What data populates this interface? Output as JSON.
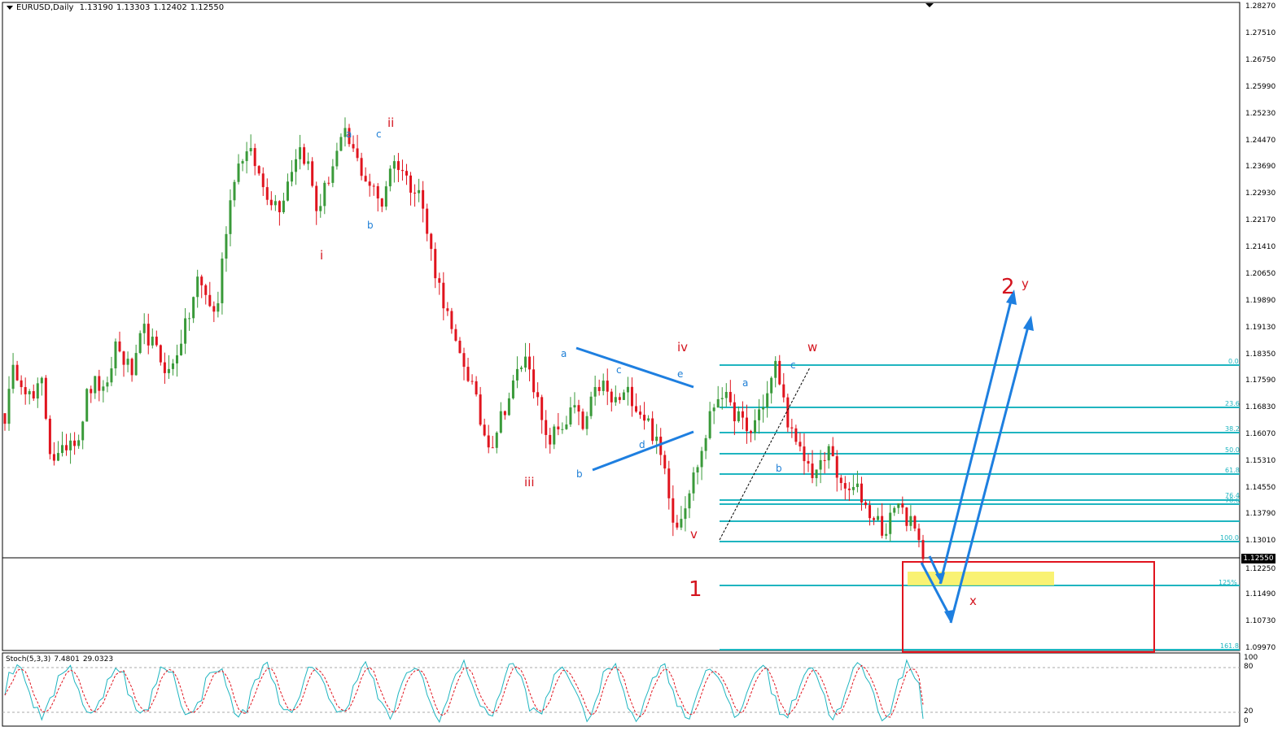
{
  "header": {
    "symbol": "EURUSD,Daily",
    "open": "1.13190",
    "high": "1.13303",
    "low": "1.12402",
    "close": "1.12550"
  },
  "stoch_header": {
    "name": "Stoch(5,3,3)",
    "main": "7.4801",
    "signal": "29.0323"
  },
  "current_price": "1.12550",
  "price_axis": [
    "1.28270",
    "1.27510",
    "1.26750",
    "1.25990",
    "1.25230",
    "1.24470",
    "1.23690",
    "1.22930",
    "1.22170",
    "1.21410",
    "1.20650",
    "1.19890",
    "1.19130",
    "1.18350",
    "1.17590",
    "1.16830",
    "1.16070",
    "1.15310",
    "1.14550",
    "1.13790",
    "1.13010",
    "1.12250",
    "1.11490",
    "1.10730",
    "1.09970"
  ],
  "stoch_axis": [
    "100",
    "80",
    "20",
    "0"
  ],
  "fib_levels": [
    "0.0",
    "23.6",
    "38.2",
    "50.0",
    "61.8",
    "76.4",
    "78.6",
    "100.0",
    "125%",
    "161.8"
  ],
  "wave_labels": {
    "i": "i",
    "ii": "ii",
    "iii": "iii",
    "iv": "iv",
    "v": "v",
    "one": "1",
    "two": "2",
    "w": "w",
    "x": "x",
    "y": "y",
    "a1": "a",
    "b1": "b",
    "c1": "c",
    "a2": "a",
    "b2": "b",
    "c2": "c",
    "d2": "d",
    "e2": "e",
    "a3": "a",
    "b3": "b",
    "c3": "c"
  },
  "colors": {
    "bull": "#3a9a3a",
    "bear": "#e0141e",
    "fib": "#1fb5c0",
    "arrow": "#1e7fe0",
    "label_red": "#d4141e",
    "label_blue": "#1e7fd6",
    "highlight": "#f8f05a",
    "target_box": "#e0141e"
  },
  "chart_data": {
    "type": "candlestick",
    "symbol": "EURUSD",
    "timeframe": "Daily",
    "ylim": [
      1.0997,
      1.2827
    ],
    "current_price": 1.1255,
    "close_anchors": [
      1.166,
      1.18,
      1.176,
      1.17,
      1.176,
      1.155,
      1.154,
      1.16,
      1.16,
      1.173,
      1.176,
      1.171,
      1.187,
      1.182,
      1.178,
      1.191,
      1.187,
      1.182,
      1.178,
      1.187,
      1.194,
      1.205,
      1.2,
      1.194,
      1.218,
      1.235,
      1.241,
      1.24,
      1.232,
      1.228,
      1.226,
      1.235,
      1.243,
      1.238,
      1.224,
      1.232,
      1.24,
      1.246,
      1.241,
      1.235,
      1.231,
      1.226,
      1.238,
      1.238,
      1.232,
      1.232,
      1.218,
      1.206,
      1.197,
      1.186,
      1.181,
      1.174,
      1.162,
      1.158,
      1.166,
      1.172,
      1.18,
      1.183,
      1.17,
      1.158,
      1.162,
      1.164,
      1.169,
      1.162,
      1.171,
      1.176,
      1.17,
      1.171,
      1.173,
      1.168,
      1.165,
      1.158,
      1.15,
      1.134,
      1.141,
      1.149,
      1.157,
      1.168,
      1.174,
      1.168,
      1.166,
      1.16,
      1.167,
      1.172,
      1.181,
      1.168,
      1.158,
      1.154,
      1.15,
      1.152,
      1.158,
      1.145,
      1.145,
      1.145,
      1.139,
      1.137,
      1.132,
      1.143,
      1.138,
      1.134,
      1.1255
    ],
    "stochastic": {
      "name": "Stoch(5,3,3)",
      "main": 7.4801,
      "signal": 29.0323,
      "levels": [
        80,
        20
      ],
      "ylim": [
        0,
        100
      ]
    },
    "fibonacci": {
      "from": 1.1301,
      "to": 1.1812,
      "levels": [
        "0.0",
        "23.6",
        "38.2",
        "50.0",
        "61.8",
        "76.4",
        "78.6",
        "100.0",
        "125%",
        "161.8"
      ]
    }
  }
}
